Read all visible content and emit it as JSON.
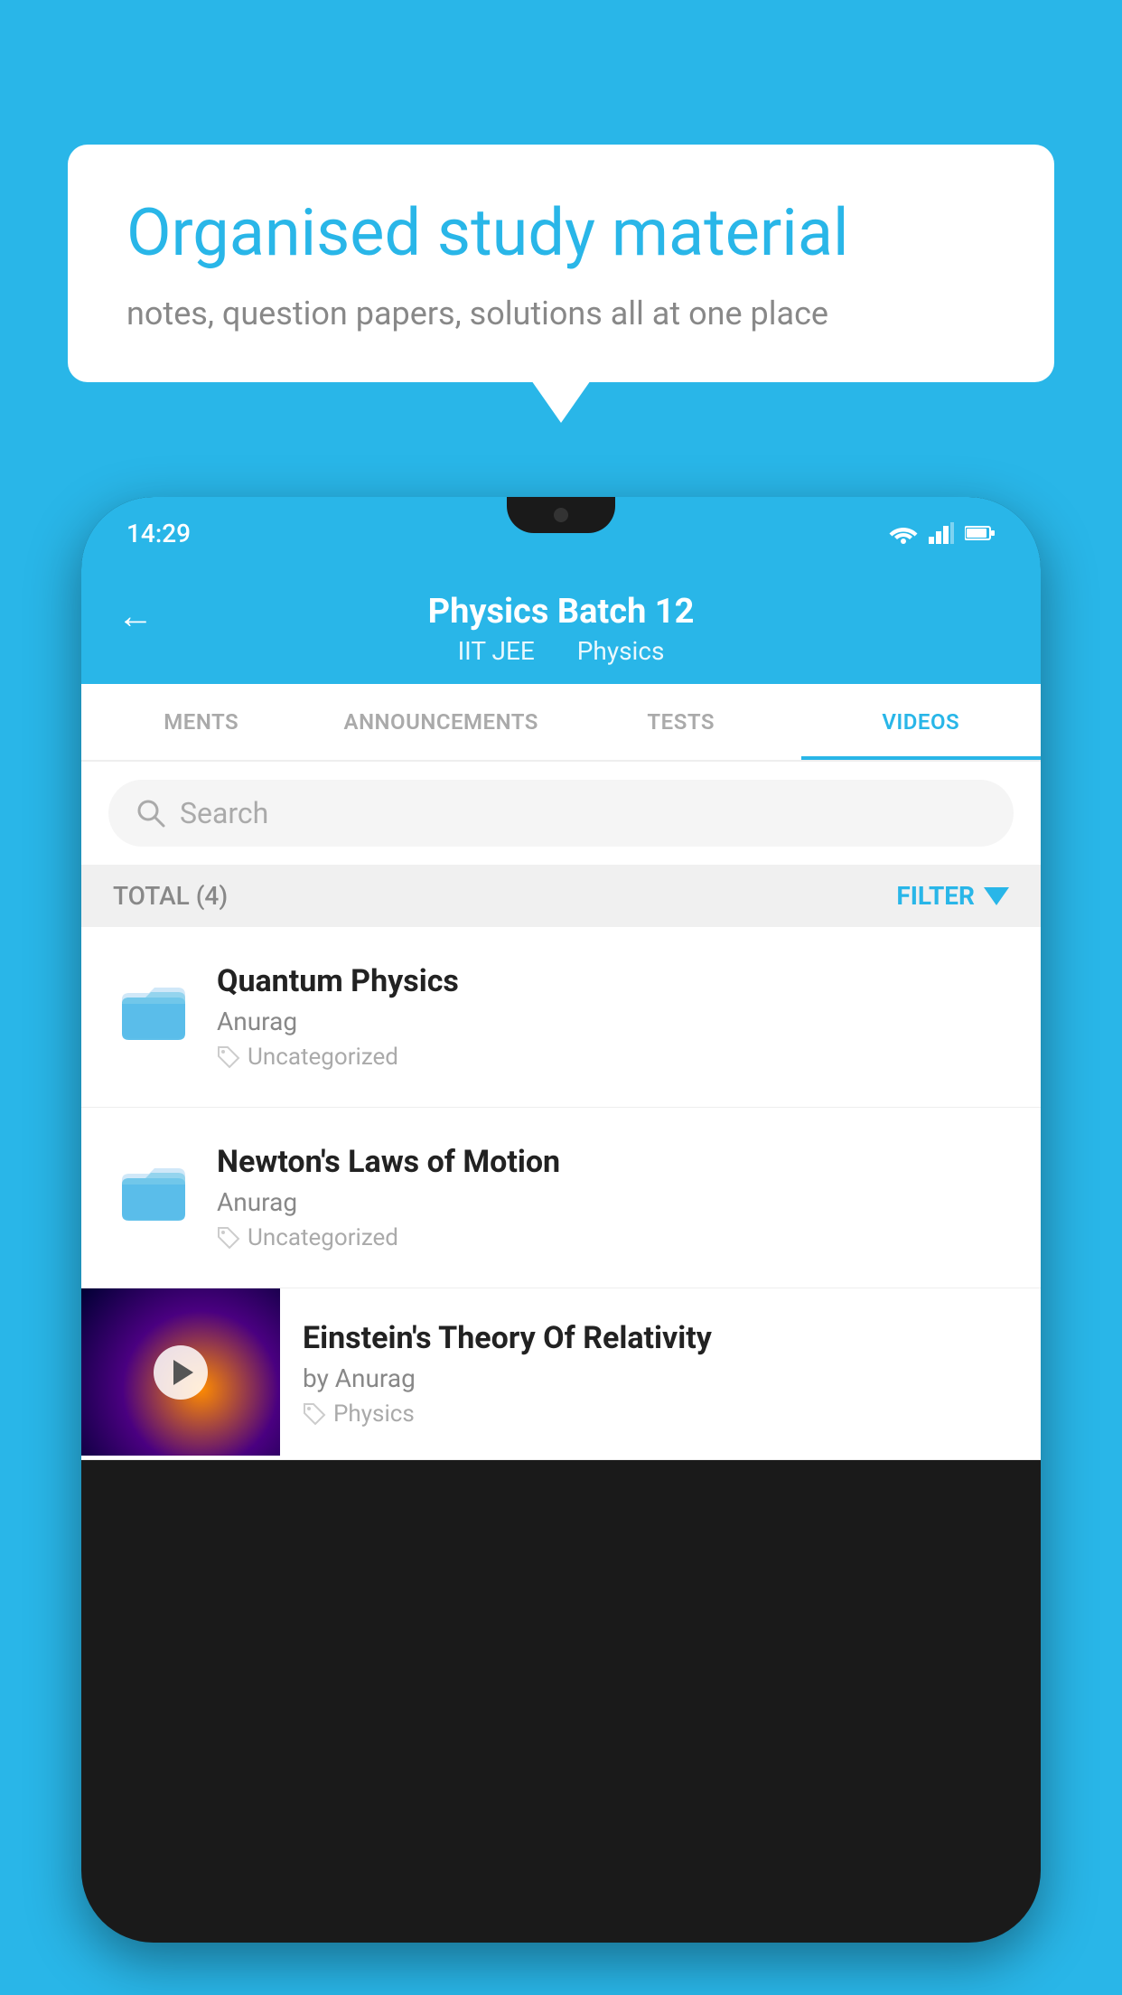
{
  "background": {
    "color": "#29b6e8"
  },
  "speech_bubble": {
    "title": "Organised study material",
    "subtitle": "notes, question papers, solutions all at one place"
  },
  "phone": {
    "status_bar": {
      "time": "14:29",
      "wifi": "▾",
      "signal": "▴",
      "battery": "▮"
    },
    "header": {
      "title": "Physics Batch 12",
      "subtitle_parts": [
        "IIT JEE",
        "Physics"
      ],
      "back_label": "←"
    },
    "tabs": [
      {
        "label": "MENTS",
        "active": false
      },
      {
        "label": "ANNOUNCEMENTS",
        "active": false
      },
      {
        "label": "TESTS",
        "active": false
      },
      {
        "label": "VIDEOS",
        "active": true
      }
    ],
    "search": {
      "placeholder": "Search"
    },
    "filter_bar": {
      "total_label": "TOTAL (4)",
      "filter_label": "FILTER"
    },
    "items": [
      {
        "type": "folder",
        "title": "Quantum Physics",
        "author": "Anurag",
        "tag": "Uncategorized"
      },
      {
        "type": "folder",
        "title": "Newton's Laws of Motion",
        "author": "Anurag",
        "tag": "Uncategorized"
      },
      {
        "type": "video",
        "title": "Einstein's Theory Of Relativity",
        "author": "by Anurag",
        "tag": "Physics"
      }
    ]
  }
}
